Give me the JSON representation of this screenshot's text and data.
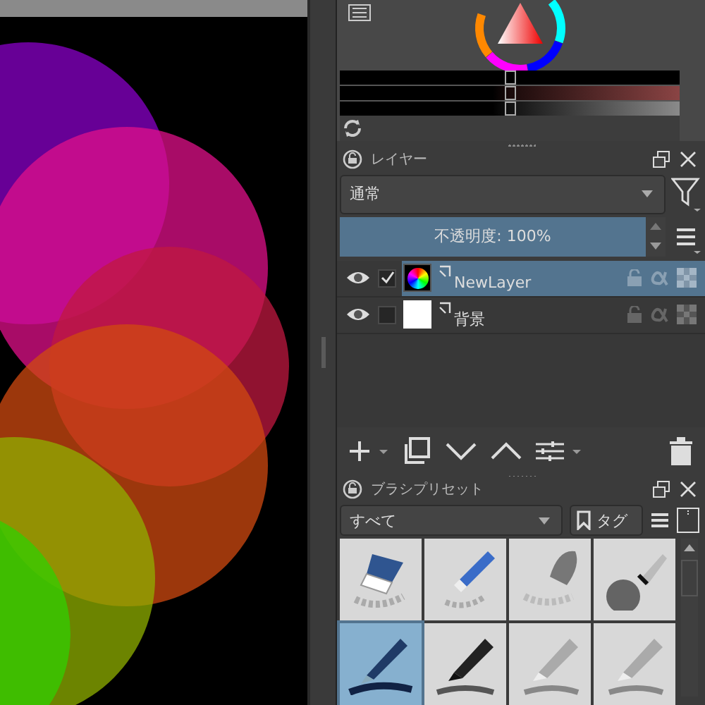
{
  "color_selector": {
    "sliders": [
      {
        "level": 0.5
      },
      {
        "level": 0.5
      },
      {
        "level": 0.5
      }
    ]
  },
  "layers_docker": {
    "title": "レイヤー",
    "blend_mode": "通常",
    "opacity": {
      "text": "不透明度: 100%",
      "level": 1
    },
    "layers": [
      {
        "name": "NewLayer",
        "selected": true,
        "checked": true,
        "visible": true,
        "kind": "wheel"
      },
      {
        "name": "背景",
        "selected": false,
        "checked": false,
        "visible": true,
        "kind": "white"
      }
    ]
  },
  "brush_presets_docker": {
    "title": "ブラシプリセット",
    "filter": "すべて",
    "tag_button": "タグ",
    "presets": [
      {
        "kind": "eraser",
        "selected": false
      },
      {
        "kind": "eraser-pen",
        "selected": false
      },
      {
        "kind": "blender",
        "selected": false
      },
      {
        "kind": "airbrush",
        "selected": false
      },
      {
        "kind": "pen",
        "selected": true
      },
      {
        "kind": "marker",
        "selected": false
      },
      {
        "kind": "pencil",
        "selected": false
      },
      {
        "kind": "pencil",
        "selected": false
      }
    ]
  }
}
